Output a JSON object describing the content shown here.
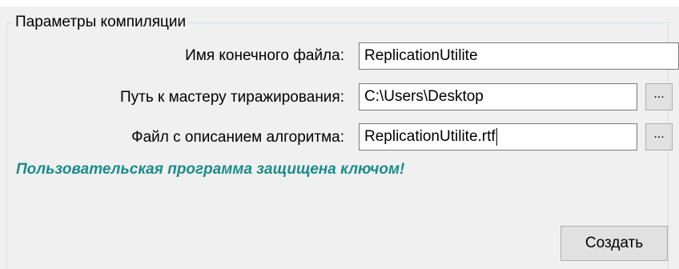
{
  "group": {
    "title": "Параметры компиляции"
  },
  "fields": {
    "output_file": {
      "label": "Имя конечного файла:",
      "value": "ReplicationUtilite"
    },
    "wizard_path": {
      "label": "Путь к мастеру тиражирования:",
      "value": "C:\\Users\\Desktop",
      "browse_label": "..."
    },
    "algorithm_file": {
      "label": "Файл с описанием алгоритма:",
      "value": "ReplicationUtilite.rtf",
      "browse_label": "..."
    }
  },
  "notice": {
    "text": "Пользовательская программа защищена ключом!",
    "color": "#1a8c8c"
  },
  "actions": {
    "create_label": "Создать"
  }
}
